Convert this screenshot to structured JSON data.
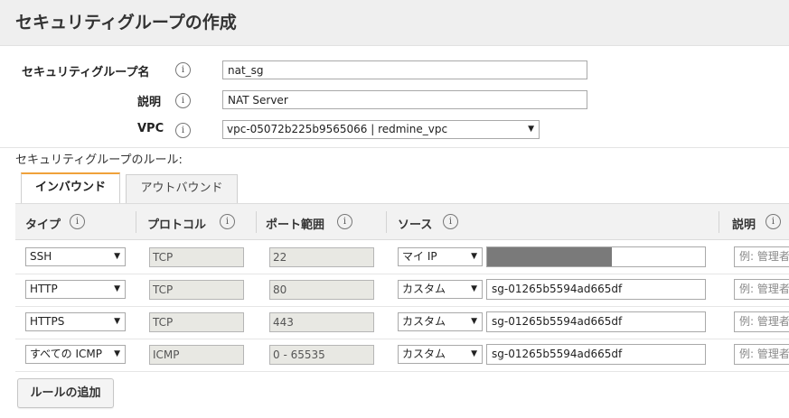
{
  "header": {
    "title": "セキュリティグループの作成"
  },
  "form": {
    "name_label": "セキュリティグループ名",
    "name_value": "nat_sg",
    "desc_label": "説明",
    "desc_value": "NAT Server",
    "vpc_label": "VPC",
    "vpc_value": "vpc-05072b225b9565066 | redmine_vpc"
  },
  "info_glyph": "i",
  "rules_label": "セキュリティグループのルール:",
  "tabs": [
    {
      "label": "インバウンド",
      "active": true
    },
    {
      "label": "アウトバウンド",
      "active": false
    }
  ],
  "columns": {
    "type": "タイプ",
    "protocol": "プロトコル",
    "port": "ポート範囲",
    "source": "ソース",
    "description": "説明"
  },
  "rules": [
    {
      "type": "SSH",
      "protocol": "TCP",
      "port": "22",
      "source_select": "マイ IP",
      "source_value": "",
      "desc_placeholder": "例: 管理者"
    },
    {
      "type": "HTTP",
      "protocol": "TCP",
      "port": "80",
      "source_select": "カスタム",
      "source_value": "sg-01265b5594ad665df",
      "desc_placeholder": "例: 管理者"
    },
    {
      "type": "HTTPS",
      "protocol": "TCP",
      "port": "443",
      "source_select": "カスタム",
      "source_value": "sg-01265b5594ad665df",
      "desc_placeholder": "例: 管理者"
    },
    {
      "type": "すべての ICMP",
      "protocol": "ICMP",
      "port": "0 - 65535",
      "source_select": "カスタム",
      "source_value": "sg-01265b5594ad665df",
      "desc_placeholder": "例: 管理者"
    }
  ],
  "add_rule_label": "ルールの追加",
  "colors": {
    "tab_accent": "#f0a13a",
    "readonly_bg": "#e8e8e3",
    "header_bg": "#efefef"
  }
}
